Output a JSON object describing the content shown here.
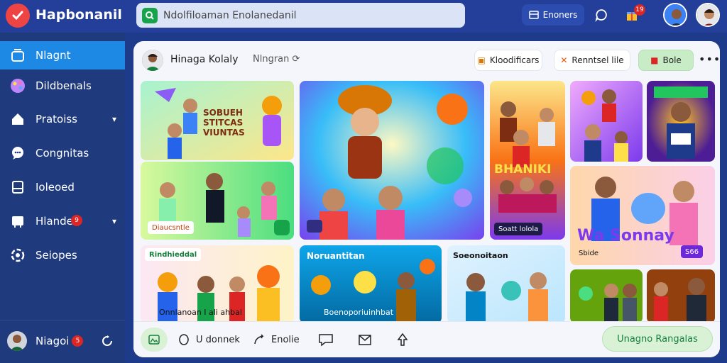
{
  "app": {
    "title": "Hapbonanil"
  },
  "search": {
    "placeholder": "Ndolfiloaman Enolanedanil"
  },
  "top": {
    "button_label": "Enoners",
    "notifications_badge": "19"
  },
  "sidebar": {
    "items": [
      {
        "label": "Nlagnt",
        "icon": "home-icon",
        "active": true
      },
      {
        "label": "Dildbenals",
        "icon": "palette-icon"
      },
      {
        "label": "Pratoiss",
        "icon": "house-icon",
        "chevron": true
      },
      {
        "label": "Congnitas",
        "icon": "chat-icon"
      },
      {
        "label": "Ioleoed",
        "icon": "bookmark-icon"
      },
      {
        "label": "Hlande",
        "icon": "tray-icon",
        "chevron": true,
        "badge": "9"
      },
      {
        "label": "Seiopes",
        "icon": "settings-icon"
      }
    ],
    "user": {
      "name": "Niagoi",
      "badge": "5"
    }
  },
  "main": {
    "title": "Hinaga Kolaly",
    "subtitle": "Nlngran",
    "pills": [
      "Kloodificars",
      "Renntsel lile",
      "Bole"
    ],
    "tiles": [
      {
        "caption": "SOBUEH STITCAS VIUNTAS"
      },
      {
        "chip": "Diaucsntle"
      },
      {
        "chip": ""
      },
      {
        "caption": "BHANIKI",
        "chip": "Soatt lolola"
      },
      {
        "caption": ""
      },
      {
        "caption": ""
      },
      {
        "caption": "Wa Sonnay",
        "chip": "Sbide",
        "chip2": "S66"
      },
      {
        "label": "Rindhieddal",
        "chip": "Onnlanoan I ali ahbal"
      },
      {
        "label": "Noruantitan",
        "chip": "Boenoporiuinhbat"
      },
      {
        "label": "Soeonoitaon"
      },
      {
        "caption": ""
      },
      {
        "caption": ""
      }
    ],
    "bottom": {
      "items": [
        "",
        "U donnek",
        "Enolie",
        "",
        "",
        ""
      ],
      "cta": "Unagno Rangalas"
    }
  },
  "colors": {
    "accent": "#1e88e5",
    "brand": "#233f9a",
    "badge": "#dc2626",
    "cta": "#15803d"
  }
}
